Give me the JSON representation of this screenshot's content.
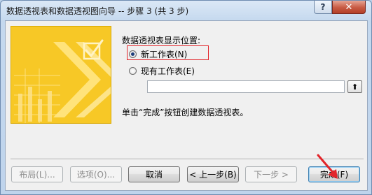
{
  "window": {
    "title": "数据透视表和数据透视图向导 -- 步骤 3 (共 3 步)"
  },
  "titlebar": {
    "help_glyph": "?",
    "close_glyph": "✕"
  },
  "placement": {
    "label": "数据透视表显示位置:",
    "option_new": "新工作表(N)",
    "option_existing": "现有工作表(E)",
    "range_value": ""
  },
  "hint": "单击“完成”按钮创建数据透视表。",
  "buttons": {
    "layout": "布局(L)...",
    "options": "选项(O)...",
    "cancel": "取消",
    "back": "< 上一步(B)",
    "next": "下一步 >",
    "finish": "完成(F)"
  },
  "icons": {
    "collapse": "⬆"
  },
  "colors": {
    "annotation_red": "#e2262b",
    "wizard_yellow": "#f6c20a"
  }
}
